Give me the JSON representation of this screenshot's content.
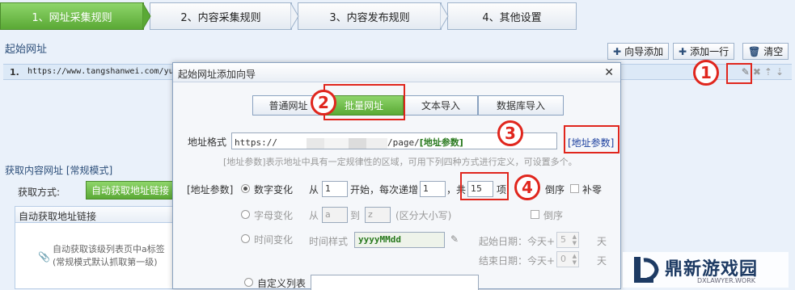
{
  "steps": [
    "1、网址采集规则",
    "2、内容采集规则",
    "3、内容发布规则",
    "4、其他设置"
  ],
  "start_section": {
    "title": "起始网址",
    "buttons": {
      "wizard_add": "向导添加",
      "add_row": "添加一行",
      "clear": "清空"
    },
    "row": {
      "index": "1.",
      "url": "https://www.tangshanwei.com/yu"
    }
  },
  "content_section": {
    "title": "获取内容网址 [常规模式]",
    "method_label": "获取方式:",
    "auto_button": "自动获取地址链接",
    "panel_header": "自动获取地址链接",
    "panel_line1": "自动获取该级列表页中a标签",
    "panel_line2": "(常规模式默认抓取第一级)"
  },
  "dialog": {
    "title": "起始网址添加向导",
    "close": "✕",
    "tabs": [
      "普通网址",
      "批量网址",
      "文本导入",
      "数据库导入"
    ],
    "active_tab": "批量网址",
    "format_label": "地址格式",
    "format_prefix": "https://",
    "format_suffix": "/page/",
    "format_param": "[地址参数]",
    "param_link": "[地址参数]",
    "hint": "[地址参数]表示地址中具有一定规律性的区域，可用下列四种方式进行定义，可设置多个。",
    "param_label": "[地址参数]",
    "numeric": {
      "label": "数字变化",
      "from": "从",
      "start": "1",
      "start_suffix": "开始，每次递增",
      "step": "1",
      "total_prefix": "，共",
      "count": "15",
      "total_suffix": "项",
      "reverse": "倒序",
      "pad": "补零"
    },
    "letter": {
      "label": "字母变化",
      "from": "从",
      "start": "a",
      "to": "到",
      "end": "z",
      "note": "(区分大小写)",
      "reverse": "倒序"
    },
    "time": {
      "label": "时间变化",
      "style_label": "时间样式",
      "style": "yyyyMMdd",
      "start_label": "起始日期：今天+",
      "start_val": "5",
      "end_label": "结束日期：今天+",
      "end_val": "0",
      "unit": "天"
    },
    "custom": {
      "label": "自定义列表"
    }
  },
  "annotations": [
    "1",
    "2",
    "3",
    "4"
  ],
  "watermark": {
    "text": "鼎新游戏园",
    "sub": "DXLAWYER.WORK"
  }
}
